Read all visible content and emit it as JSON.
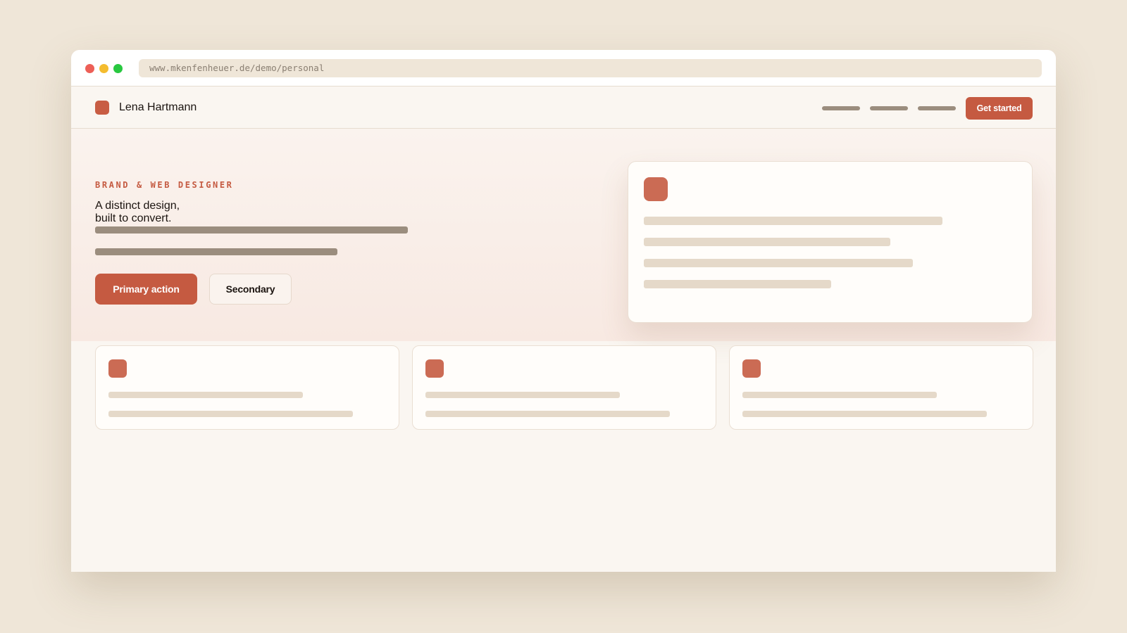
{
  "browser": {
    "url": "www.mkenfenheuer.de/demo/personal"
  },
  "header": {
    "brand_name": "Lena Hartmann",
    "cta_label": "Get started"
  },
  "hero": {
    "eyebrow": "BRAND & WEB DESIGNER",
    "headline_line1": "A distinct design,",
    "headline_line2": "built to convert.",
    "primary_label": "Primary action",
    "secondary_label": "Secondary"
  },
  "colors": {
    "accent": "#c55a41",
    "background": "#efe6d8",
    "surface": "#faf6f1",
    "placeholder_dark": "#9b8d7e",
    "placeholder_light": "#e5d9c9"
  }
}
